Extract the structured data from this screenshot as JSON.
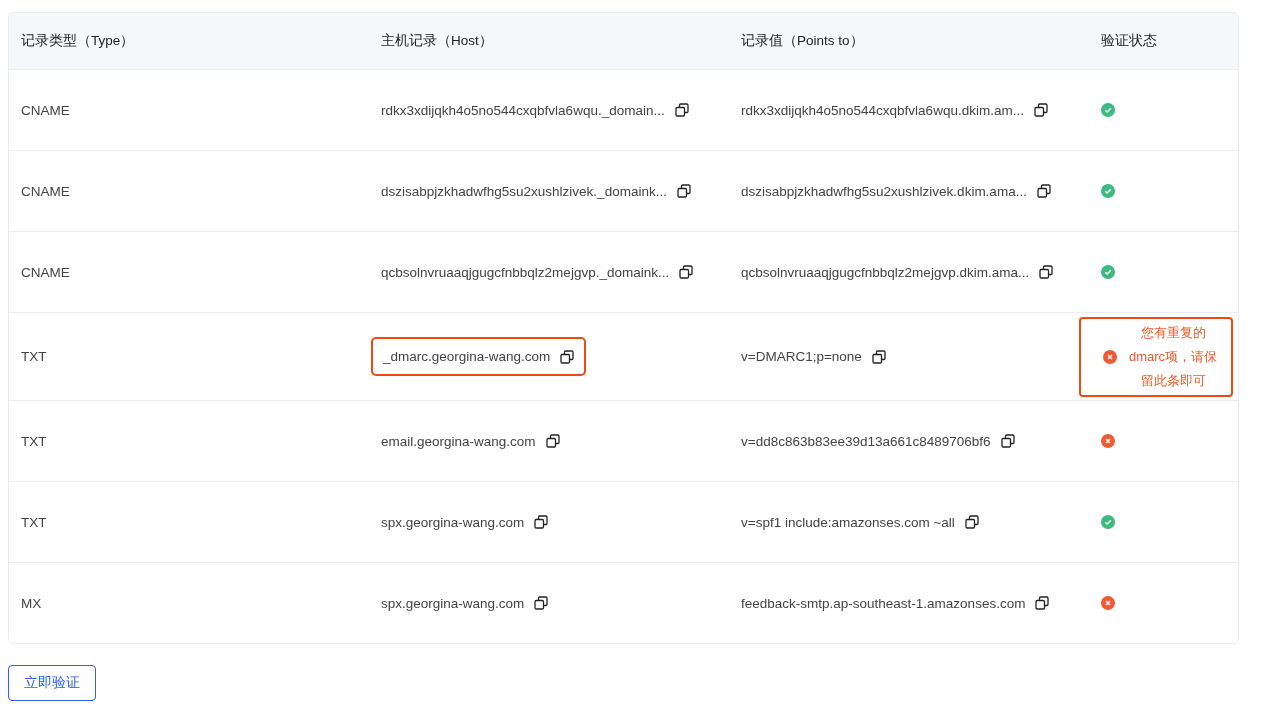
{
  "table": {
    "columns": [
      "记录类型（Type）",
      "主机记录（Host）",
      "记录值（Points to）",
      "验证状态"
    ],
    "rows": [
      {
        "type": "CNAME",
        "host": "rdkx3xdijqkh4o5no544cxqbfvla6wqu._domain...",
        "value": "rdkx3xdijqkh4o5no544cxqbfvla6wqu.dkim.am...",
        "verified": true,
        "highlighted": false
      },
      {
        "type": "CNAME",
        "host": "dszisabpjzkhadwfhg5su2xushlzivek._domaink...",
        "value": "dszisabpjzkhadwfhg5su2xushlzivek.dkim.ama...",
        "verified": true,
        "highlighted": false
      },
      {
        "type": "CNAME",
        "host": "qcbsolnvruaaqjgugcfnbbqlz2mejgvp._domaink...",
        "value": "qcbsolnvruaaqjgugcfnbbqlz2mejgvp.dkim.ama...",
        "verified": true,
        "highlighted": false
      },
      {
        "type": "TXT",
        "host": "_dmarc.georgina-wang.com",
        "value": "v=DMARC1;p=none",
        "verified": false,
        "message": "您有重复的dmarc项，请保留此条即可",
        "highlighted": true
      },
      {
        "type": "TXT",
        "host": "email.georgina-wang.com",
        "value": "v=dd8c863b83ee39d13a661c8489706bf6",
        "verified": false,
        "highlighted": false
      },
      {
        "type": "TXT",
        "host": "spx.georgina-wang.com",
        "value": "v=spf1 include:amazonses.com ~all",
        "verified": true,
        "highlighted": false
      },
      {
        "type": "MX",
        "host": "spx.georgina-wang.com",
        "value": "feedback-smtp.ap-southeast-1.amazonses.com",
        "verified": false,
        "highlighted": false
      }
    ]
  },
  "verify_button": "立即验证"
}
